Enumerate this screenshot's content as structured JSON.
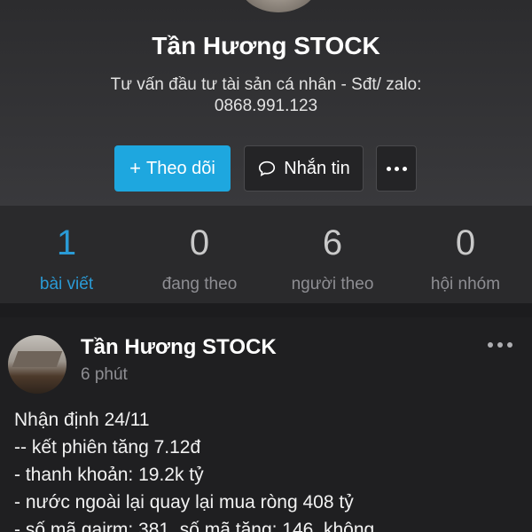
{
  "profile": {
    "name": "Tần Hương STOCK",
    "bio_line1": "Tư vấn đầu tư tài sản cá nhân - Sđt/ zalo:",
    "bio_line2": "0868.991.123"
  },
  "actions": {
    "follow_label": "Theo dõi",
    "follow_icon": "plus-icon",
    "message_label": "Nhắn tin",
    "message_icon": "chat-bubble-icon",
    "more_icon": "more-horizontal-icon"
  },
  "stats": [
    {
      "value": "1",
      "label": "bài viết"
    },
    {
      "value": "0",
      "label": "đang theo"
    },
    {
      "value": "6",
      "label": "người theo"
    },
    {
      "value": "0",
      "label": "hội nhóm"
    }
  ],
  "post": {
    "author": "Tần Hương STOCK",
    "time": "6 phút",
    "lines": [
      "Nhận định 24/11",
      "-- kết phiên tăng 7.12đ",
      "- thanh khoản: 19.2k tỷ",
      "- nước ngoài lại quay lại mua ròng 408 tỷ",
      "- số mã gairm: 381, số mã tăng: 146, không"
    ]
  },
  "colors": {
    "accent": "#1ea7df",
    "active_stat": "#2a9bd6",
    "background": "#1c1c1e"
  }
}
